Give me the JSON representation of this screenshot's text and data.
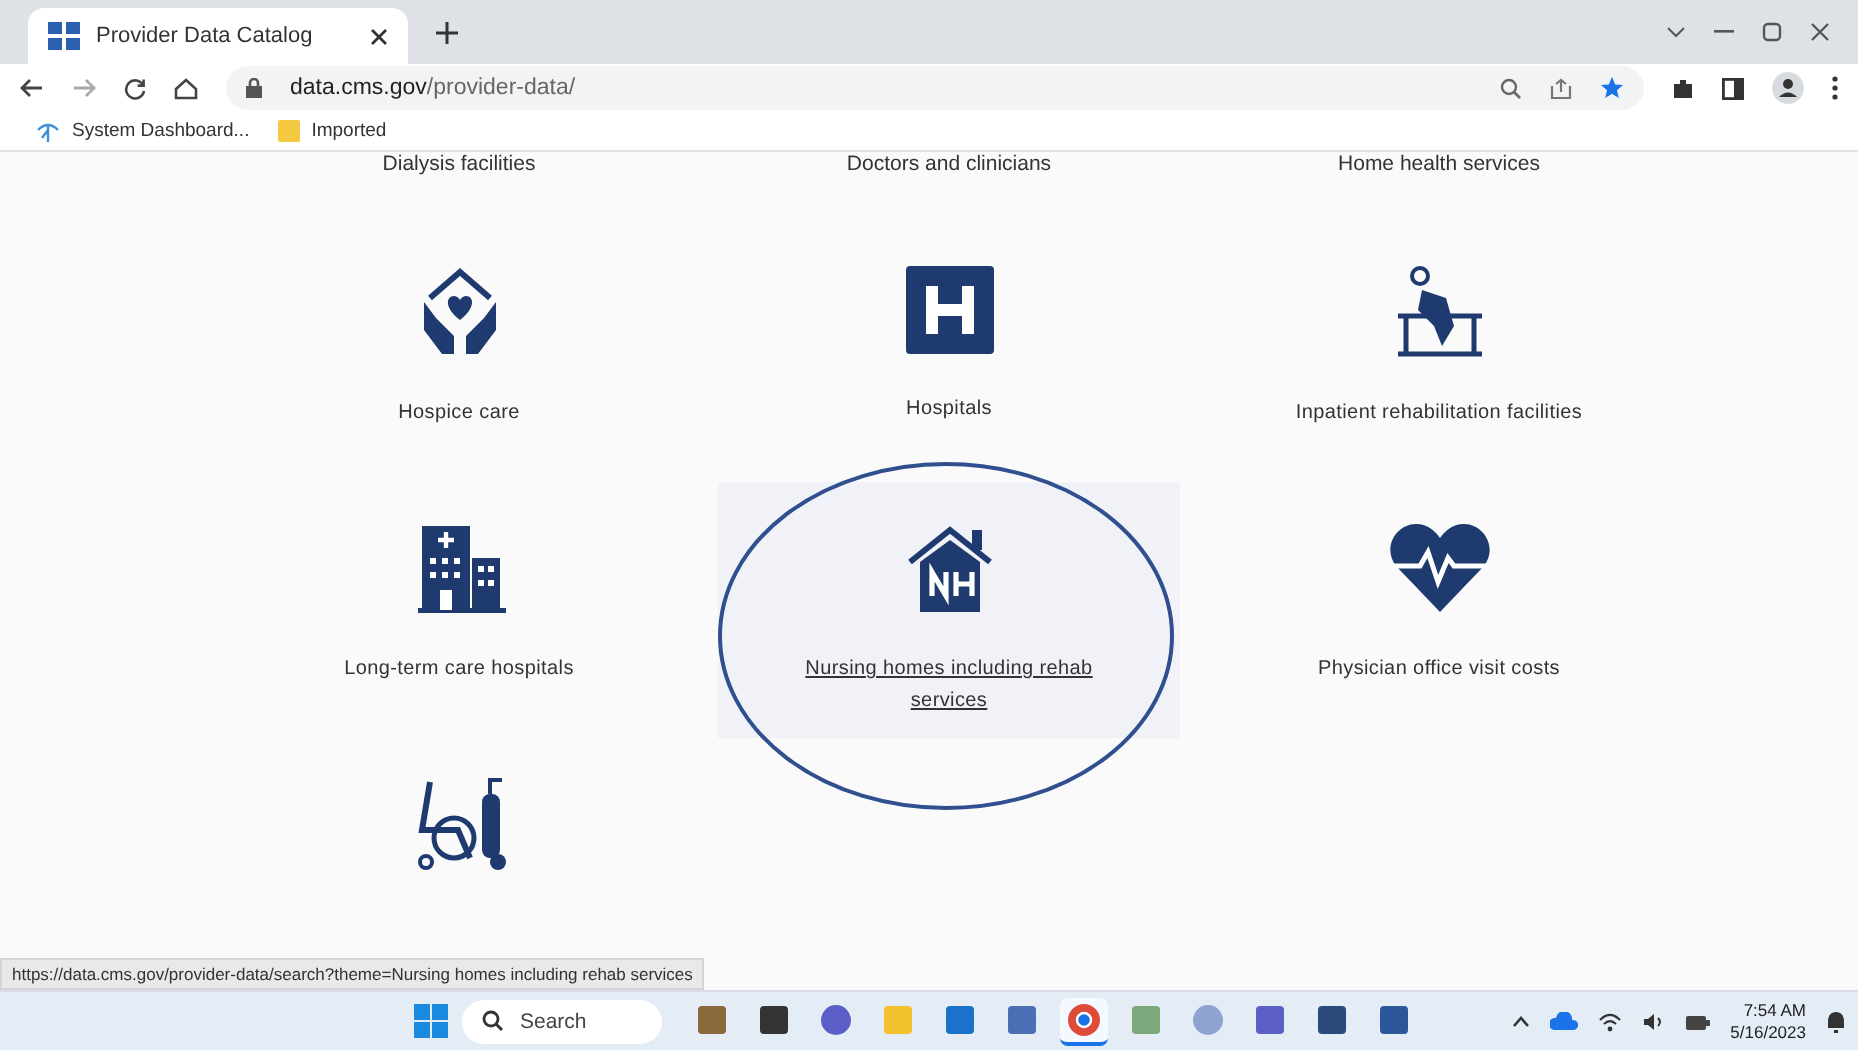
{
  "browser": {
    "tab_title": "Provider Data Catalog",
    "url_domain": "data.cms.gov",
    "url_path": "/provider-data/",
    "bookmarks": [
      {
        "label": "System Dashboard...",
        "kind": "app"
      },
      {
        "label": "Imported",
        "kind": "folder"
      }
    ]
  },
  "top_row": [
    "Dialysis facilities",
    "Doctors and clinicians",
    "Home health services"
  ],
  "categories": [
    {
      "label": "Hospice care",
      "kind": "hospice",
      "hovered": false
    },
    {
      "label": "Hospitals",
      "kind": "hospital",
      "hovered": false
    },
    {
      "label": "Inpatient rehabilitation facilities",
      "kind": "rehab",
      "hovered": false
    },
    {
      "label": "Long-term care hospitals",
      "kind": "longterm",
      "hovered": false
    },
    {
      "label": "Nursing homes including rehab services",
      "kind": "nursing",
      "hovered": true,
      "circled": true
    },
    {
      "label": "Physician office visit costs",
      "kind": "physician",
      "hovered": false
    },
    {
      "kind": "supplier"
    }
  ],
  "status_url": "https://data.cms.gov/provider-data/search?theme=Nursing homes including rehab services",
  "taskbar": {
    "search_placeholder": "Search",
    "apps": [
      {
        "kind": "photos"
      },
      {
        "kind": "dark"
      },
      {
        "kind": "chat"
      },
      {
        "kind": "explorer"
      },
      {
        "kind": "outlook"
      },
      {
        "kind": "network"
      },
      {
        "kind": "chrome",
        "active": true
      },
      {
        "kind": "green"
      },
      {
        "kind": "r"
      },
      {
        "kind": "teams"
      },
      {
        "kind": "blade"
      },
      {
        "kind": "word"
      }
    ],
    "time": "7:54 AM",
    "date": "5/16/2023"
  }
}
